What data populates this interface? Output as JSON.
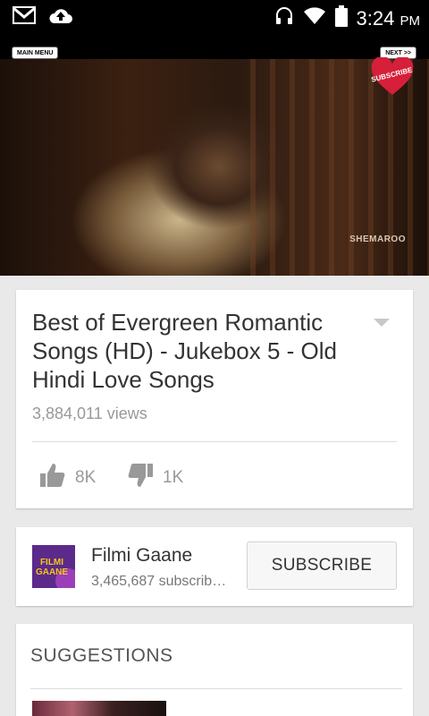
{
  "status_bar": {
    "time": "3:24",
    "ampm": "PM",
    "icons": [
      "gmail-icon",
      "upload-icon",
      "headset-icon",
      "wifi-icon",
      "battery-icon"
    ]
  },
  "player": {
    "main_menu_label": "MAIN MENU",
    "next_label": "NEXT >>",
    "subscribe_overlay_label": "SUBSCRIBE",
    "watermark": "SHEMAROO"
  },
  "video": {
    "title": "Best of Evergreen Romantic Songs (HD) - Jukebox 5 - Old Hindi Love Songs",
    "views": "3,884,011 views",
    "likes": "8K",
    "dislikes": "1K"
  },
  "channel": {
    "name": "Filmi Gaane",
    "subscribers": "3,465,687 subscribers",
    "logo_line1": "FILMI",
    "logo_line2": "GAANE",
    "subscribe_label": "SUBSCRIBE"
  },
  "suggestions": {
    "title": "SUGGESTIONS"
  },
  "colors": {
    "background": "#e9e9e9",
    "card": "#ffffff",
    "text_primary": "#333333",
    "text_secondary": "#999999",
    "channel_logo_bg": "#5b2a8a",
    "subscribe_heart": "#d61f3a"
  }
}
